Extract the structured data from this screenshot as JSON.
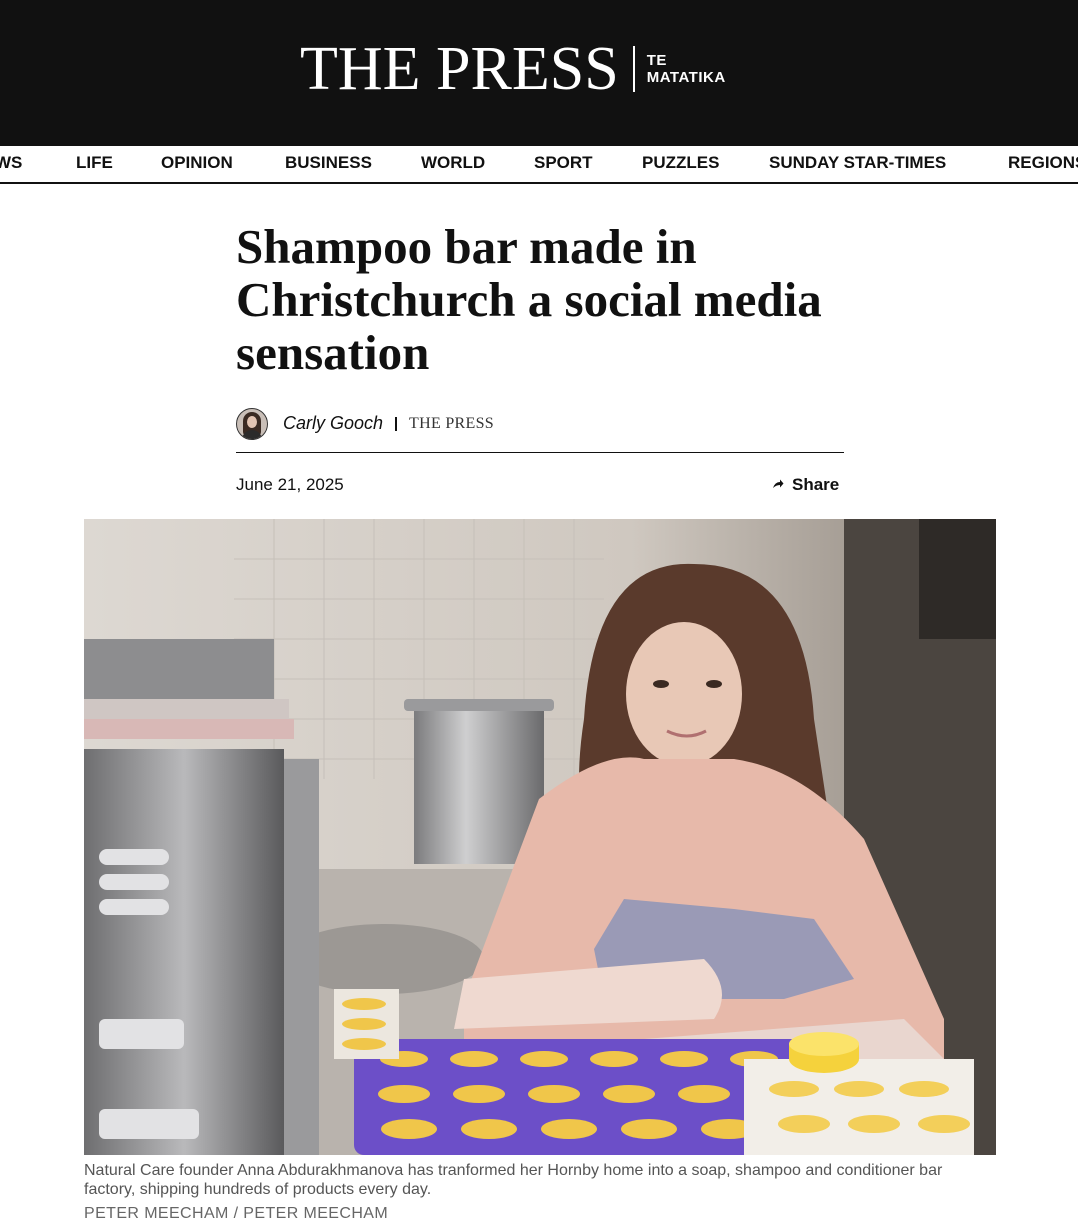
{
  "masthead": {
    "title": "THE PRESS",
    "sub_line1": "TE",
    "sub_line2": "MATATIKA"
  },
  "nav": {
    "items": [
      "WS",
      "LIFE",
      "OPINION",
      "BUSINESS",
      "WORLD",
      "SPORT",
      "PUZZLES",
      "SUNDAY STAR-TIMES",
      "REGIONS"
    ]
  },
  "article": {
    "headline": "Shampoo bar made in Christchurch a social media sensation",
    "author": "Carly Gooch",
    "publication": "THE PRESS",
    "date": "June 21, 2025",
    "share_label": "Share",
    "caption": "Natural Care founder Anna Abdurakhmanova has tranformed her Hornby home into a soap, shampoo and conditioner bar factory, shipping hundreds of products every day.",
    "credit": "PETER MEECHAM / PETER MEECHAM"
  },
  "icons": {
    "share": "share-arrow-icon",
    "avatar": "author-avatar"
  },
  "colors": {
    "masthead_bg": "#111111",
    "text": "#111111",
    "caption": "#555555"
  }
}
